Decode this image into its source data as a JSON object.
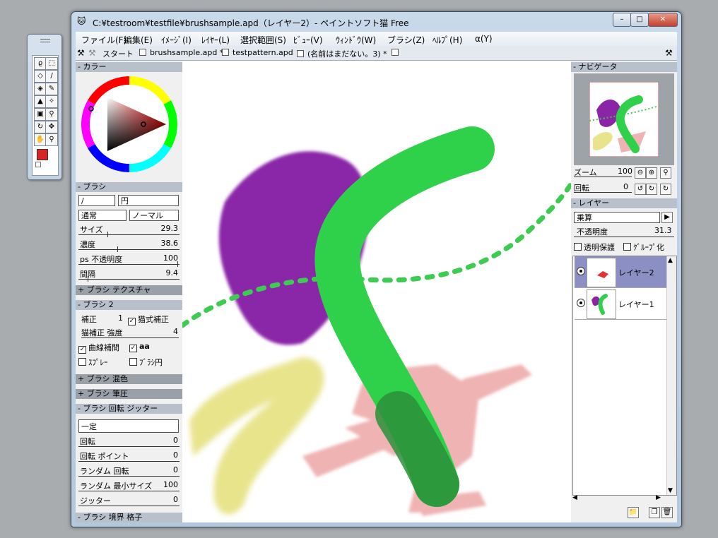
{
  "window": {
    "title": "C:¥testroom¥testfile¥brushsample.apd（レイヤー2）- ペイントソフト猫 Free",
    "controls": {
      "minimize": "–",
      "maximize": "□",
      "close": "✕"
    }
  },
  "menu": [
    "ファイル(F)",
    "編集(E)",
    "ｲﾒｰｼﾞ(I)",
    "ﾚｲﾔｰ(L)",
    "選択範囲(S)",
    "ﾋﾞｭｰ(V)",
    "ｳｨﾝﾄﾞｳ(W)",
    "ブラシ(Z)",
    "ﾍﾙﾌﾟ(H)",
    "α(Y)"
  ],
  "tabs": [
    "スタート",
    "brushsample.apd *",
    "testpattern.apd",
    "(名前はまだない。3) *"
  ],
  "color_panel": {
    "header": "カラー",
    "foreground": "#d92424",
    "background": "#ffffff"
  },
  "brush_panel": {
    "header": "ブラシ",
    "shape_field": "/",
    "shape_name": "円",
    "mode": "通常",
    "blend": "ノーマル",
    "sliders": [
      {
        "label": "サイズ",
        "value": "29.3",
        "fraction": 0.29
      },
      {
        "label": "濃度",
        "value": "38.6",
        "fraction": 0.39
      },
      {
        "label": "ps 不透明度",
        "value": "100",
        "fraction": 1.0
      },
      {
        "label": "間隔",
        "value": "9.4",
        "fraction": 0.09
      }
    ]
  },
  "brush_texture_header": "+ ブラシ テクスチャ",
  "brush2_panel": {
    "header": "ブラシ 2",
    "correction_label": "補正",
    "correction_value": "1",
    "cat_correction": "猫式補正",
    "cat_strength_label": "猫補正 強度",
    "cat_strength_value": "4",
    "curve_interp": "曲線補間",
    "aa": "aa",
    "spray": "ｽﾌﾟﾚｰ",
    "brush_circle": "ﾌﾞﾗｼ円"
  },
  "brush_mix_header": "+ ブラシ 混色",
  "brush_pressure_header": "+ ブラシ 筆圧",
  "rotation_panel": {
    "header": "ブラシ 回転 ジッター",
    "mode": "一定",
    "sliders": [
      {
        "label": "回転",
        "value": "0"
      },
      {
        "label": "回転 ポイント",
        "value": "0"
      },
      {
        "label": "ランダム 回転",
        "value": "0"
      },
      {
        "label": "ランダム 最小サイズ",
        "value": "100"
      },
      {
        "label": "ジッター",
        "value": "0"
      }
    ]
  },
  "brush_grid_header": "ブラシ 境界 格子",
  "navigator": {
    "header": "ナビゲータ",
    "zoom_label": "ズーム",
    "zoom_value": "100",
    "rotate_label": "回転",
    "rotate_value": "0"
  },
  "layer_panel": {
    "header": "レイヤー",
    "blend_mode": "乗算",
    "opacity_label": "不透明度",
    "opacity_value": "31.3",
    "protect_alpha": "透明保護",
    "group": "ｸﾞﾙｰﾌﾟ化",
    "layers": [
      {
        "name": "レイヤー2",
        "selected": true
      },
      {
        "name": "レイヤー1",
        "selected": false
      }
    ]
  }
}
